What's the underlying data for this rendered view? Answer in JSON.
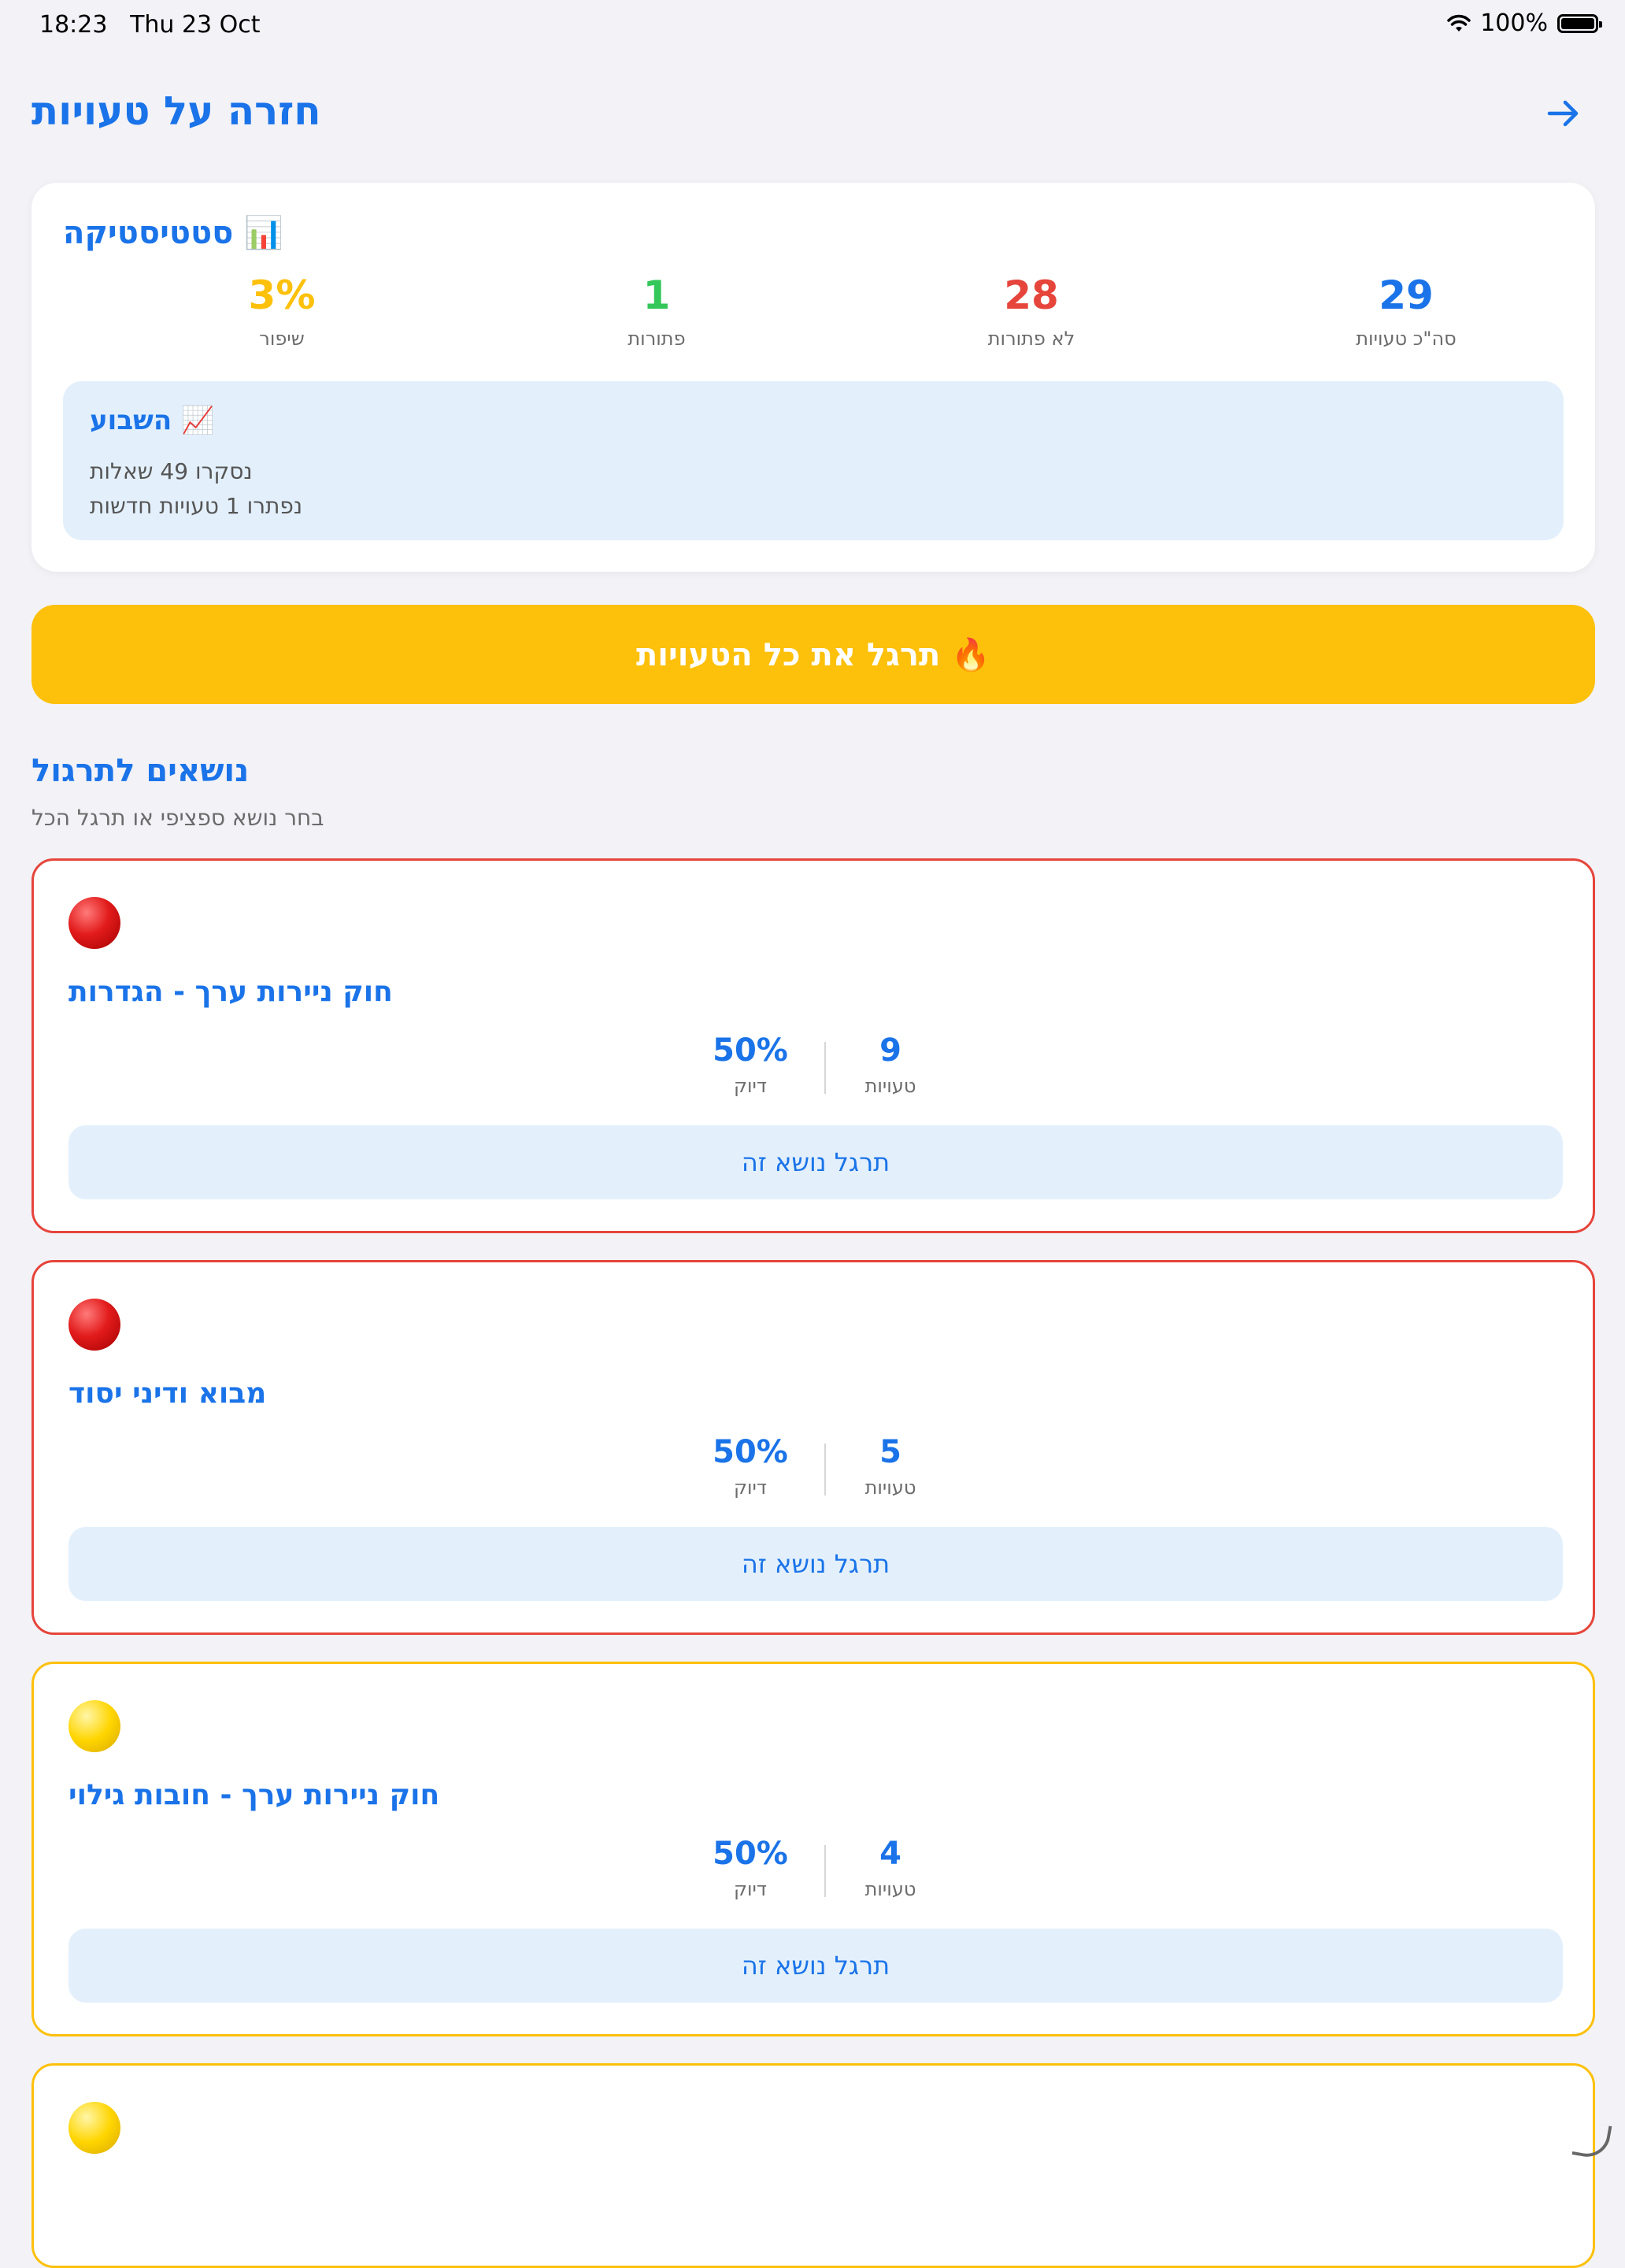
{
  "status_bar": {
    "time": "18:23",
    "date": "Thu 23 Oct",
    "battery": "100%",
    "wifi_icon": "wifi-icon"
  },
  "header": {
    "title": "חזרה על טעויות",
    "back_icon": "arrow-right-icon"
  },
  "statistics": {
    "title": "📊 סטטיסטיקה",
    "items": [
      {
        "value": "3%",
        "label": "שיפור",
        "color": "#fdc00b"
      },
      {
        "value": "1",
        "label": "פתורות",
        "color": "#34c759"
      },
      {
        "value": "28",
        "label": "לא פתורות",
        "color": "#e6453b"
      },
      {
        "value": "29",
        "label": "סה\"כ טעויות",
        "color": "#1a73e8"
      }
    ],
    "week": {
      "title": "📈 השבוע",
      "line1": "נסקרו 49 שאלות",
      "line2": "נפתרו 1 טעויות חדשות"
    }
  },
  "cta": {
    "label": "🔥 תרגל את כל הטעויות"
  },
  "topics_section": {
    "title": "נושאים לתרגול",
    "subtitle": "בחר נושא ספציפי או תרגל הכל",
    "cards": [
      {
        "name": "חוק ניירות ערך - הגדרות",
        "status": "red",
        "accuracy": "50%",
        "accuracy_label": "דיוק",
        "mistakes": "9",
        "mistakes_label": "טעויות",
        "button": "תרגל נושא זה"
      },
      {
        "name": "מבוא ודיני יסוד",
        "status": "red",
        "accuracy": "50%",
        "accuracy_label": "דיוק",
        "mistakes": "5",
        "mistakes_label": "טעויות",
        "button": "תרגל נושא זה"
      },
      {
        "name": "חוק ניירות ערך - חובות גילוי",
        "status": "yellow",
        "accuracy": "50%",
        "accuracy_label": "דיוק",
        "mistakes": "4",
        "mistakes_label": "טעויות",
        "button": "תרגל נושא זה"
      }
    ],
    "partial_card_status": "yellow"
  }
}
